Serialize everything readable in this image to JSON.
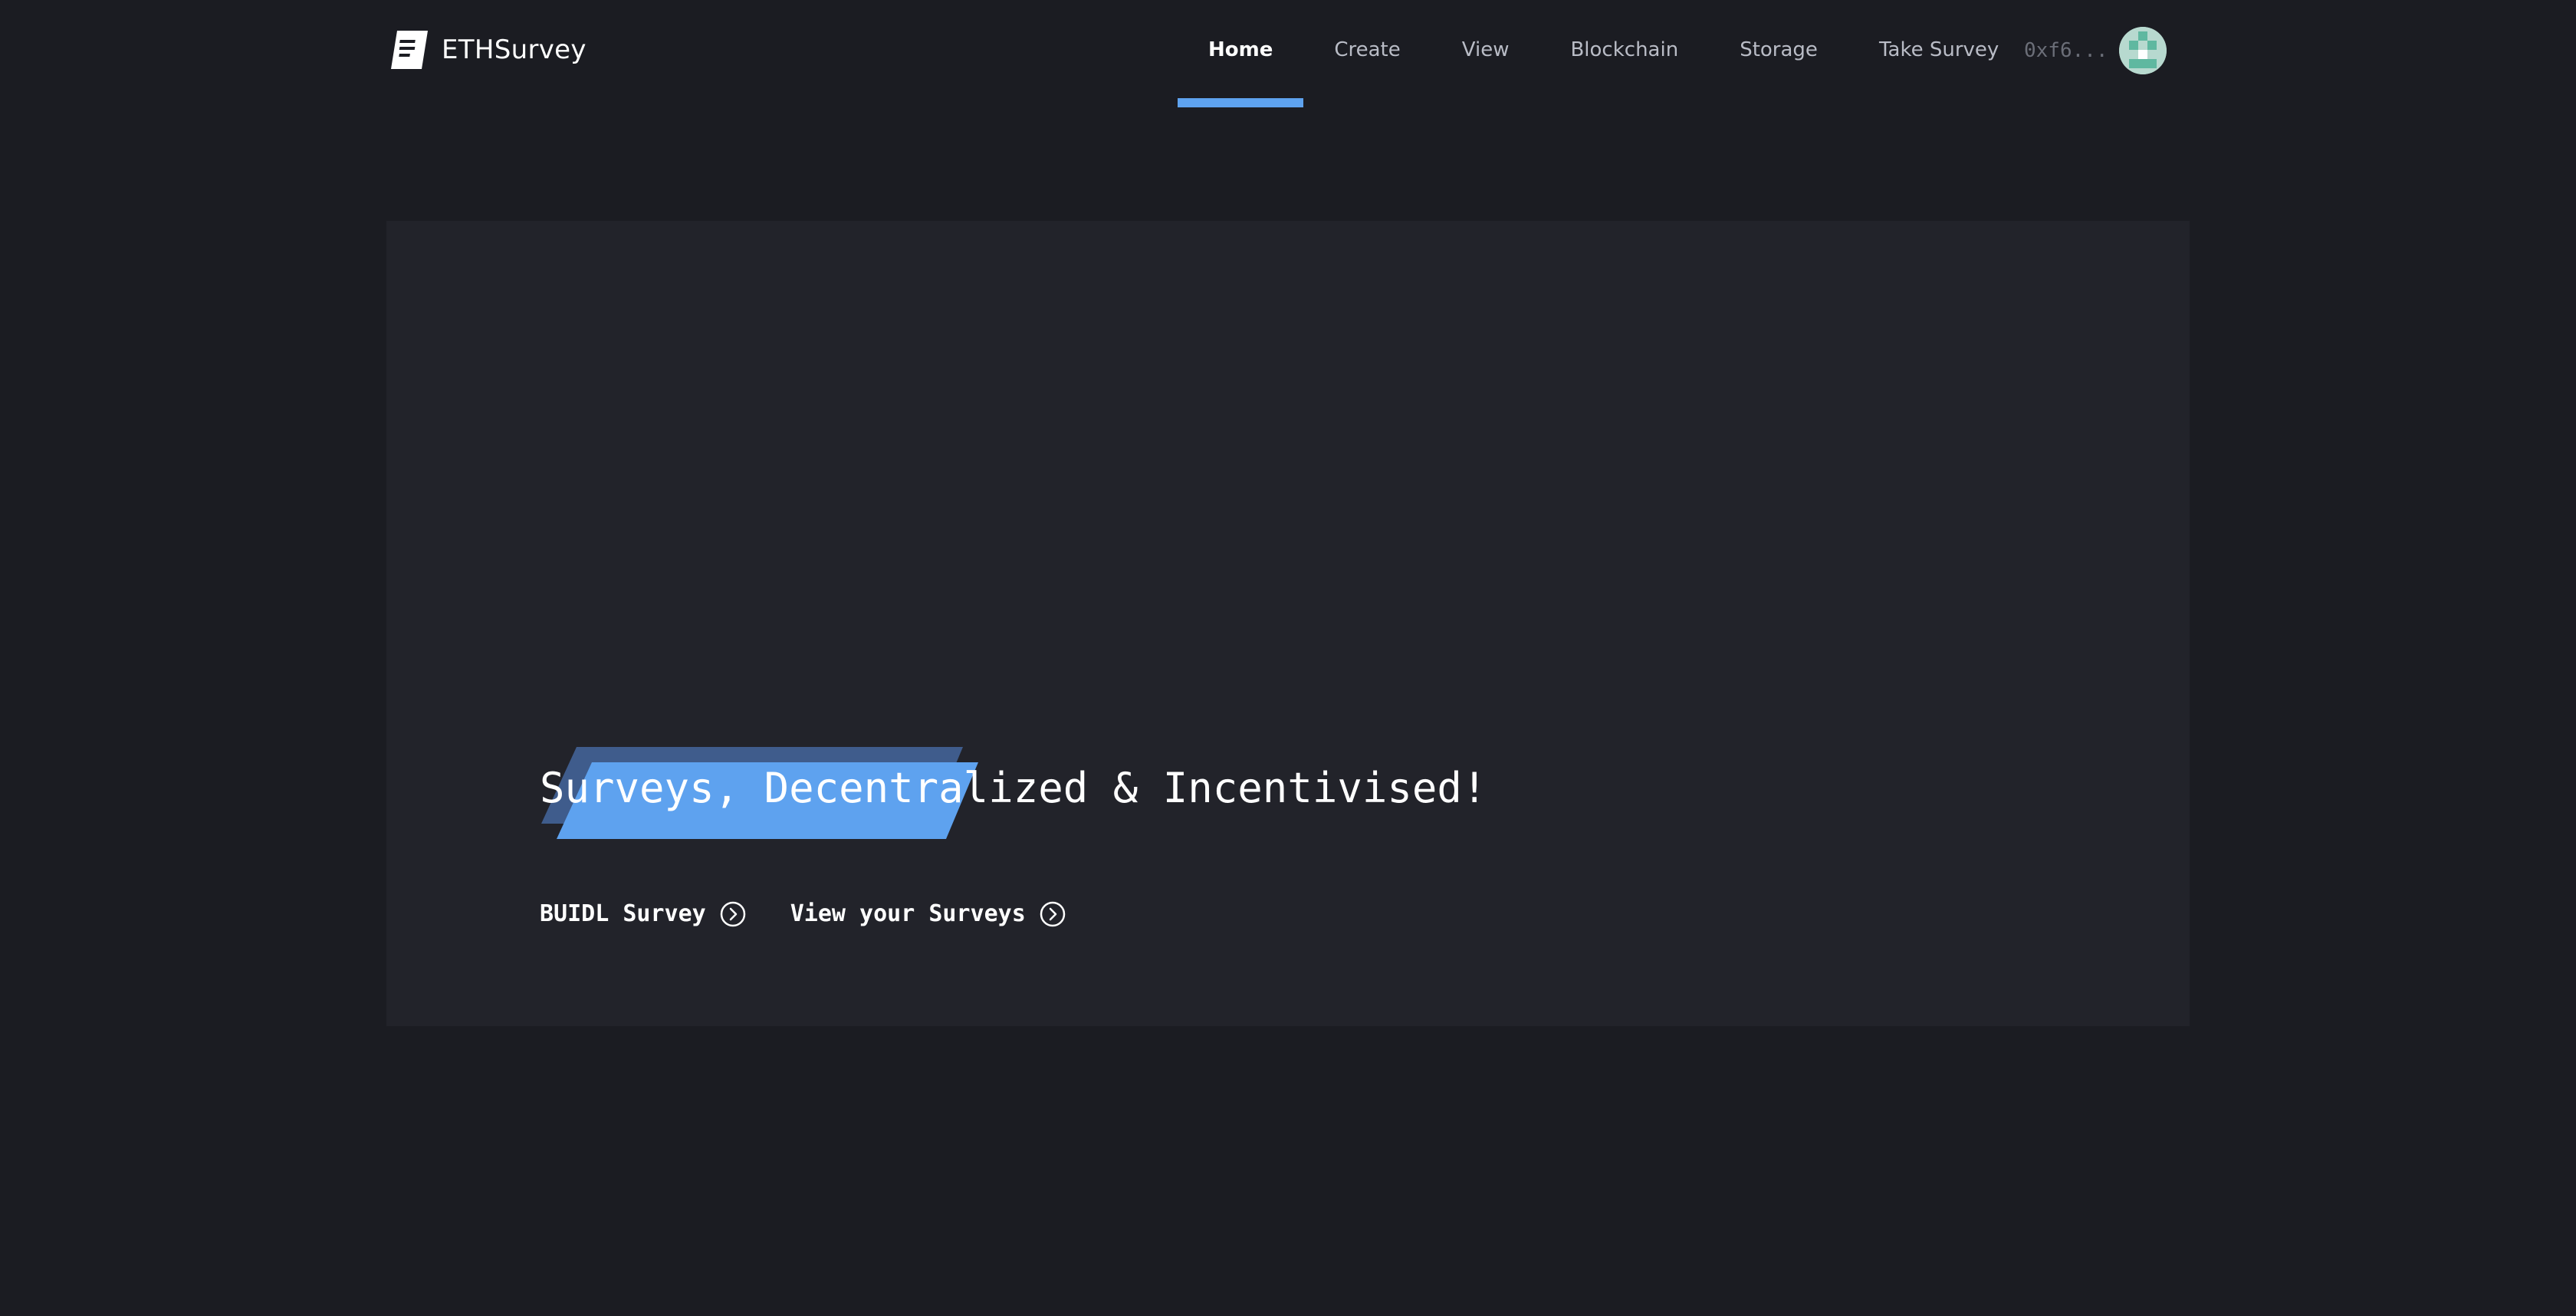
{
  "brand": {
    "name": "ETHSurvey",
    "logo_icon": "survey-document-icon"
  },
  "nav": {
    "items": [
      {
        "label": "Home",
        "active": true
      },
      {
        "label": "Create",
        "active": false
      },
      {
        "label": "View",
        "active": false
      },
      {
        "label": "Blockchain",
        "active": false
      },
      {
        "label": "Storage",
        "active": false
      },
      {
        "label": "Take Survey",
        "active": false
      }
    ]
  },
  "account": {
    "address": "0xf6...",
    "avatar_icon": "identicon-avatar"
  },
  "hero": {
    "title": "Surveys, Decentralized & Incentivised!",
    "actions": [
      {
        "label": "BUIDL Survey",
        "icon": "chevron-right-circle-icon"
      },
      {
        "label": "View your Surveys",
        "icon": "chevron-right-circle-icon"
      }
    ]
  },
  "colors": {
    "background": "#1b1c22",
    "panel": "#22232a",
    "accent": "#5ea2ef",
    "accent_shadow": "#3f5c8c",
    "nav_text": "#b9bcc6",
    "muted_text": "#6b6e78",
    "avatar_teal": "#5fb8a0"
  }
}
